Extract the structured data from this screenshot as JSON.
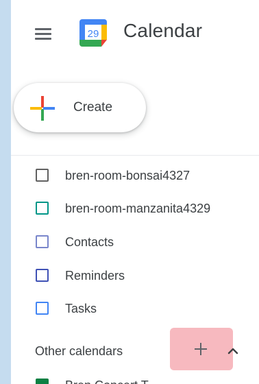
{
  "app": {
    "title": "Calendar",
    "logo_day": "29"
  },
  "create": {
    "label": "Create"
  },
  "my_calendars": [
    {
      "label": "bren-room-bonsai4327",
      "color": "#616161"
    },
    {
      "label": "bren-room-manzanita4329",
      "color": "#009688"
    },
    {
      "label": "Contacts",
      "color": "#7986cb"
    },
    {
      "label": "Reminders",
      "color": "#3f51b5"
    },
    {
      "label": "Tasks",
      "color": "#4285f4"
    }
  ],
  "other_calendars": {
    "label": "Other calendars",
    "partial_item": {
      "label": "Bren Concert T...",
      "color": "#0b8043"
    }
  },
  "colors": {
    "page_bg": "#c5dcef",
    "add_highlight": "#f7b9bf",
    "blue": "#4285f4",
    "red": "#ea4335",
    "yellow": "#fbbc04",
    "green": "#34a853"
  },
  "icons": [
    "menu-icon",
    "calendar-logo-icon",
    "plus-icon",
    "add-icon",
    "chevron-up-icon"
  ]
}
